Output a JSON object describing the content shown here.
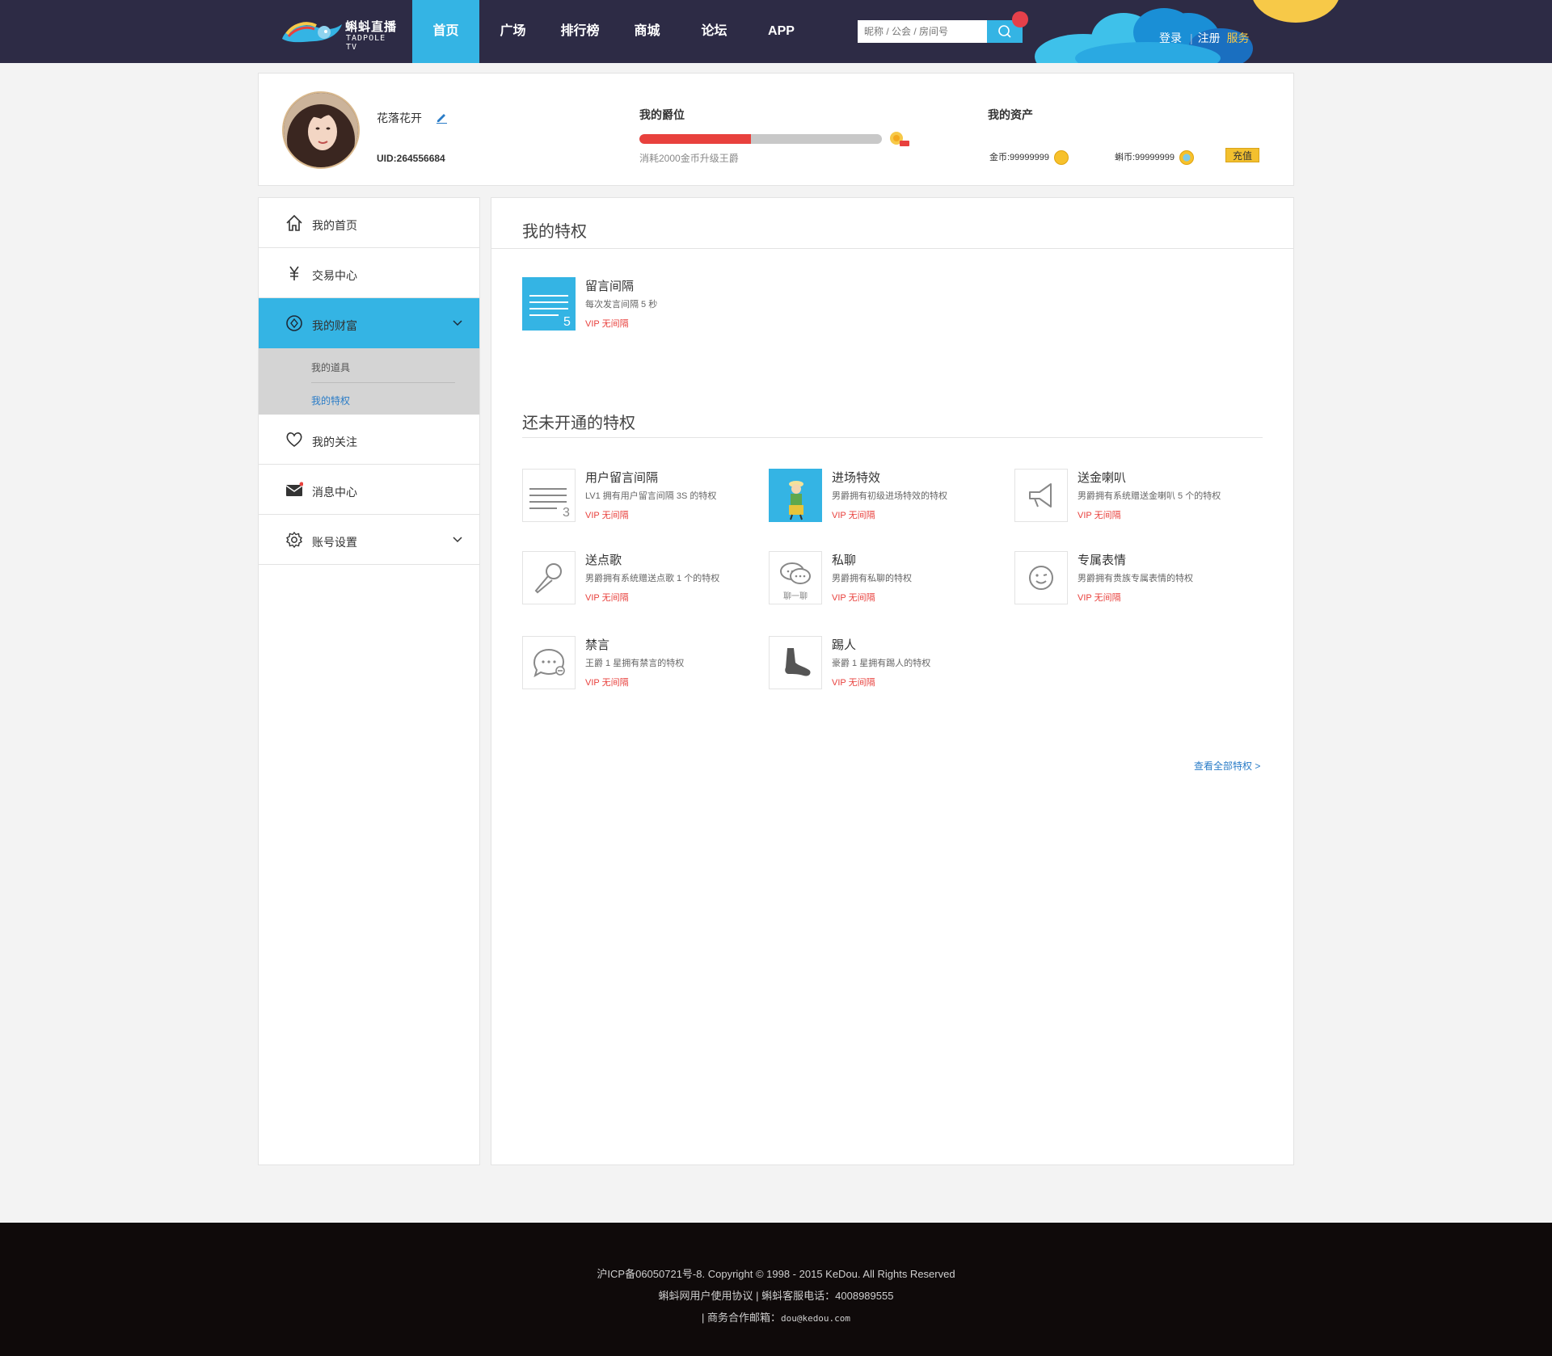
{
  "header": {
    "logo_cn": "蝌蚪直播",
    "logo_en": "TADPOLE TV",
    "nav": [
      "首页",
      "广场",
      "排行榜",
      "商城",
      "论坛",
      "APP"
    ],
    "active_nav": "首页",
    "search_placeholder": "昵称 / 公会 / 房间号",
    "login": "登录",
    "register": "注册",
    "service": "服务",
    "accent_color": "#34b4e4",
    "bg_color": "#2d2b45"
  },
  "profile": {
    "username": "花落花开",
    "uid": "UID:264556684",
    "rank_title": "我的爵位",
    "rank_progress": 0.46,
    "rank_desc": "消耗2000金币升级王爵",
    "assets_title": "我的资产",
    "gold_label": "金币:99999999",
    "tadpole_label": "蝌币:99999999",
    "recharge": "充值"
  },
  "sidebar": {
    "items": [
      {
        "label": "我的首页",
        "icon": "home-icon"
      },
      {
        "label": "交易中心",
        "icon": "yen-icon"
      },
      {
        "label": "我的财富",
        "icon": "wealth-icon",
        "active": true
      },
      {
        "label": "我的关注",
        "icon": "heart-icon"
      },
      {
        "label": "消息中心",
        "icon": "mail-icon"
      },
      {
        "label": "账号设置",
        "icon": "gear-icon"
      }
    ],
    "sub_items": [
      "我的道具",
      "我的特权"
    ]
  },
  "main": {
    "title": "我的特权",
    "owned": [
      {
        "name": "留言间隔",
        "desc": "每次发言间隔 5 秒",
        "vip": "VIP 无间隔"
      }
    ],
    "unowned_title": "还未开通的特权",
    "unowned": [
      {
        "name": "用户留言间隔",
        "desc": "LV1 拥有用户留言间隔 3S 的特权",
        "vip": "VIP 无间隔"
      },
      {
        "name": "进场特效",
        "desc": "男爵拥有初级进场特效的特权",
        "vip": "VIP 无间隔"
      },
      {
        "name": "送金喇叭",
        "desc": "男爵拥有系统赠送金喇叭 5 个的特权",
        "vip": "VIP 无间隔"
      },
      {
        "name": "送点歌",
        "desc": "男爵拥有系统赠送点歌 1 个的特权",
        "vip": "VIP 无间隔"
      },
      {
        "name": "私聊",
        "desc": "男爵拥有私聊的特权",
        "vip": "VIP 无间隔"
      },
      {
        "name": "专属表情",
        "desc": "男爵拥有贵族专属表情的特权",
        "vip": "VIP 无间隔"
      },
      {
        "name": "禁言",
        "desc": "王爵 1 星拥有禁言的特权",
        "vip": "VIP 无间隔"
      },
      {
        "name": "踢人",
        "desc": "豪爵 1 星拥有踢人的特权",
        "vip": "VIP 无间隔"
      }
    ],
    "view_all": "查看全部特权 >",
    "chat_icon_caption": "聊一聊"
  },
  "footer": {
    "line1": "沪ICP备06050721号-8.  Copyright © 1998 - 2015 KeDou. All Rights Reserved",
    "line2": "蝌蚪网用户使用协议  |  蝌蚪客服电话：4008989555",
    "line3_prefix": "|  商务合作邮箱：",
    "line3_email": "dou@kedou.com"
  }
}
